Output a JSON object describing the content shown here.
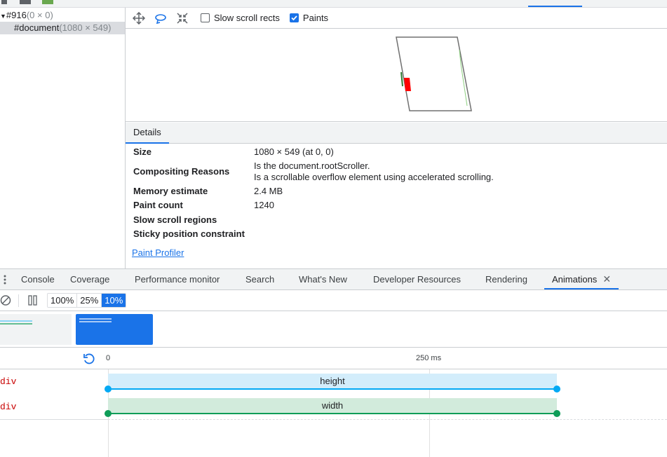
{
  "layer_tree": {
    "items": [
      {
        "name": "#916",
        "dims": "(0 × 0)"
      },
      {
        "name": "#document",
        "dims": "(1080 × 549)"
      }
    ]
  },
  "layer_toolbar": {
    "slow_scroll_label": "Slow scroll rects",
    "slow_scroll_checked": false,
    "paints_label": "Paints",
    "paints_checked": true
  },
  "details": {
    "tab_label": "Details",
    "size_key": "Size",
    "size_val": "1080 × 549 (at 0, 0)",
    "compositing_key": "Compositing Reasons",
    "compositing_val_1": "Is the document.rootScroller.",
    "compositing_val_2": "Is a scrollable overflow element using accelerated scrolling.",
    "memory_key": "Memory estimate",
    "memory_val": "2.4 MB",
    "paint_count_key": "Paint count",
    "paint_count_val": "1240",
    "slow_scroll_key": "Slow scroll regions",
    "sticky_key": "Sticky position constraint",
    "paint_profiler": "Paint Profiler"
  },
  "drawer_tabs": [
    "Console",
    "Coverage",
    "Performance monitor",
    "Search",
    "What's New",
    "Developer Resources",
    "Rendering",
    "Animations"
  ],
  "animations_close": "✕",
  "speeds": [
    "100%",
    "25%",
    "10%"
  ],
  "active_speed": "10%",
  "timeline": {
    "tick_0": "0",
    "tick_250": "250 ms",
    "rows": [
      {
        "node": "div",
        "property": "height",
        "color": "#03a9f4",
        "bg": "#d3edfb"
      },
      {
        "node": "div",
        "property": "width",
        "color": "#0f9d58",
        "bg": "#d2ebdc"
      }
    ]
  },
  "colors": {
    "accent": "#1a73e8",
    "paint_highlight": "#ff0000"
  }
}
